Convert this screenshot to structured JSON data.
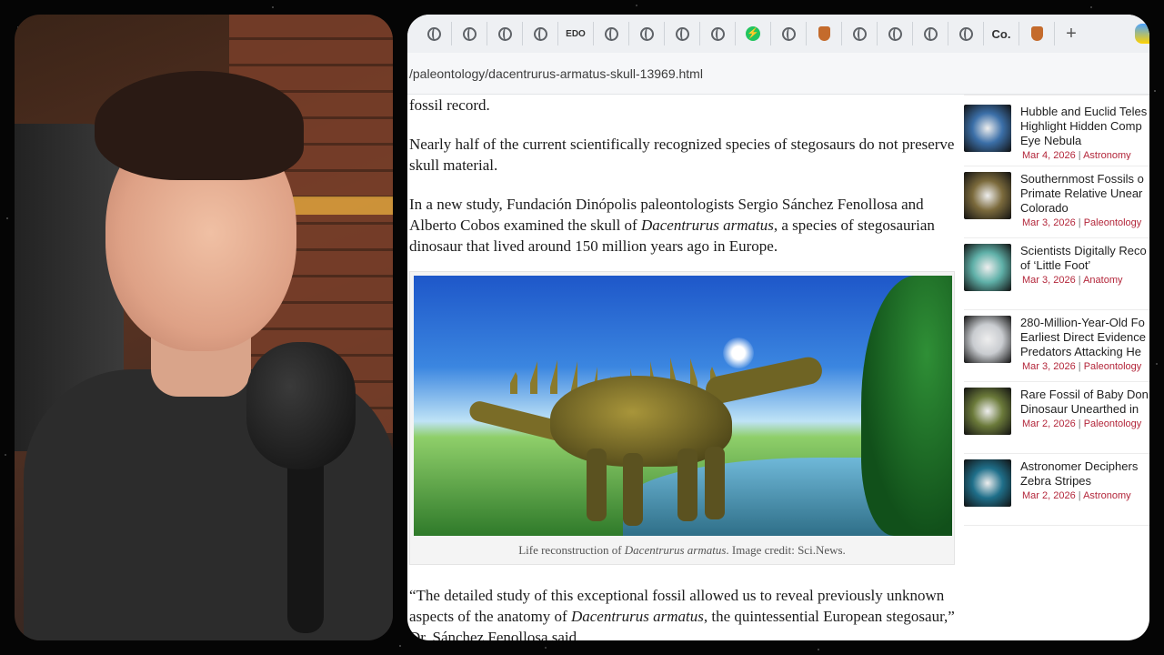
{
  "browser": {
    "tabs": [
      {
        "icon": "globe-icon",
        "text": ""
      },
      {
        "icon": "globe-icon",
        "text": ""
      },
      {
        "icon": "globe-icon",
        "text": ""
      },
      {
        "icon": "globe-icon",
        "text": ""
      },
      {
        "icon": "edo-icon",
        "text": "EDO"
      },
      {
        "icon": "globe-icon",
        "text": ""
      },
      {
        "icon": "globe-icon",
        "text": ""
      },
      {
        "icon": "globe-icon",
        "text": ""
      },
      {
        "icon": "globe-icon",
        "text": ""
      },
      {
        "icon": "bolt-icon",
        "text": "⚡"
      },
      {
        "icon": "globe-icon",
        "text": ""
      },
      {
        "icon": "shield-icon",
        "text": ""
      },
      {
        "icon": "globe-icon",
        "text": ""
      },
      {
        "icon": "globe-icon",
        "text": ""
      },
      {
        "icon": "globe-icon",
        "text": ""
      },
      {
        "icon": "globe-icon",
        "text": ""
      },
      {
        "icon": "co-icon",
        "text": "Co."
      },
      {
        "icon": "shield-icon",
        "text": ""
      }
    ],
    "new_tab_label": "+",
    "url": "/paleontology/dacentrurus-armatus-skull-13969.html"
  },
  "article": {
    "p0": "fossil record.",
    "p1": "Nearly half of the current scientifically recognized species of stegosaurs do not preserve skull material.",
    "p2_a": "In a new study, Fundación Dinópolis paleontologists Sergio Sánchez Fenollosa and Alberto Cobos examined the skull of ",
    "p2_em": "Dacentrurus armatus",
    "p2_b": ", a species of stegosaurian dinosaur that lived around 150 million years ago in Europe.",
    "caption_a": "Life reconstruction of ",
    "caption_em": "Dacentrurus armatus",
    "caption_b": ". Image credit: Sci.News.",
    "p3_a": "“The detailed study of this exceptional fossil allowed us to reveal previously unknown aspects of the anatomy of ",
    "p3_em": "Dacentrurus armatus",
    "p3_b": ", the quintessential European stegosaur,” Dr. Sánchez Fenollosa said."
  },
  "sidebar": {
    "items": [
      {
        "title_l1": "Hubble and Euclid Teles",
        "title_l2": "Highlight Hidden Comp",
        "title_l3": "Eye Nebula",
        "date": "Mar 4, 2026",
        "category": "Astronomy",
        "thumb": "#3b6fa8"
      },
      {
        "title_l1": "Southernmost Fossils o",
        "title_l2": "Primate Relative Unear",
        "title_l3": "Colorado",
        "date": "Mar 3, 2026",
        "category": "Paleontology",
        "thumb": "#7b6a3c"
      },
      {
        "title_l1": "Scientists Digitally Reco",
        "title_l2": "of ‘Little Foot’",
        "title_l3": "",
        "date": "Mar 3, 2026",
        "category": "Anatomy",
        "thumb": "#5fb0a8"
      },
      {
        "title_l1": "280-Million-Year-Old Fo",
        "title_l2": "Earliest Direct Evidence",
        "title_l3": "Predators Attacking He",
        "date": "Mar 3, 2026",
        "category": "Paleontology",
        "thumb": "#c9ccd0"
      },
      {
        "title_l1": "Rare Fossil of Baby Don",
        "title_l2": "Dinosaur Unearthed in",
        "title_l3": "",
        "date": "Mar 2, 2026",
        "category": "Paleontology",
        "thumb": "#6b7a3a"
      },
      {
        "title_l1": "Astronomer Deciphers",
        "title_l2": "Zebra Stripes",
        "title_l3": "",
        "date": "Mar 2, 2026",
        "category": "Astronomy",
        "thumb": "#1f6f8a"
      }
    ]
  }
}
